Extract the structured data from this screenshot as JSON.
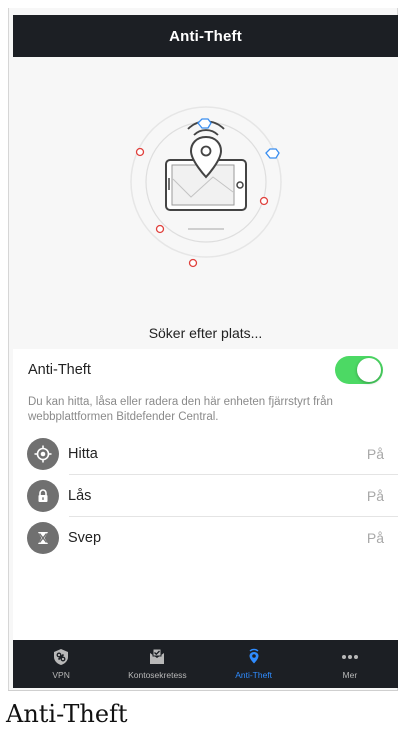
{
  "header": {
    "title": "Anti-Theft"
  },
  "hero": {
    "status": "Söker efter plats..."
  },
  "setting": {
    "label": "Anti-Theft",
    "enabled": true,
    "toggle_color": "#4cd964"
  },
  "description": "Du kan hitta, låsa eller radera den här enheten fjärrstyrt från webbplattformen Bitdefender Central.",
  "features": [
    {
      "name": "Hitta",
      "state": "På",
      "icon": "locate-icon"
    },
    {
      "name": "Lås",
      "state": "På",
      "icon": "lock-icon"
    },
    {
      "name": "Svep",
      "state": "På",
      "icon": "wipe-icon"
    }
  ],
  "tabs": [
    {
      "label": "VPN",
      "icon": "vpn-shield-icon",
      "active": false
    },
    {
      "label": "Kontosekretess",
      "icon": "account-privacy-icon",
      "active": false
    },
    {
      "label": "Anti-Theft",
      "icon": "location-pin-icon",
      "active": true
    },
    {
      "label": "Mer",
      "icon": "more-icon",
      "active": false
    }
  ],
  "caption": "Anti-Theft",
  "colors": {
    "accent": "#2f8cff",
    "nav_background": "#1c1f24",
    "red_dot": "#e0403c",
    "blue_dot": "#3a8ef0"
  }
}
